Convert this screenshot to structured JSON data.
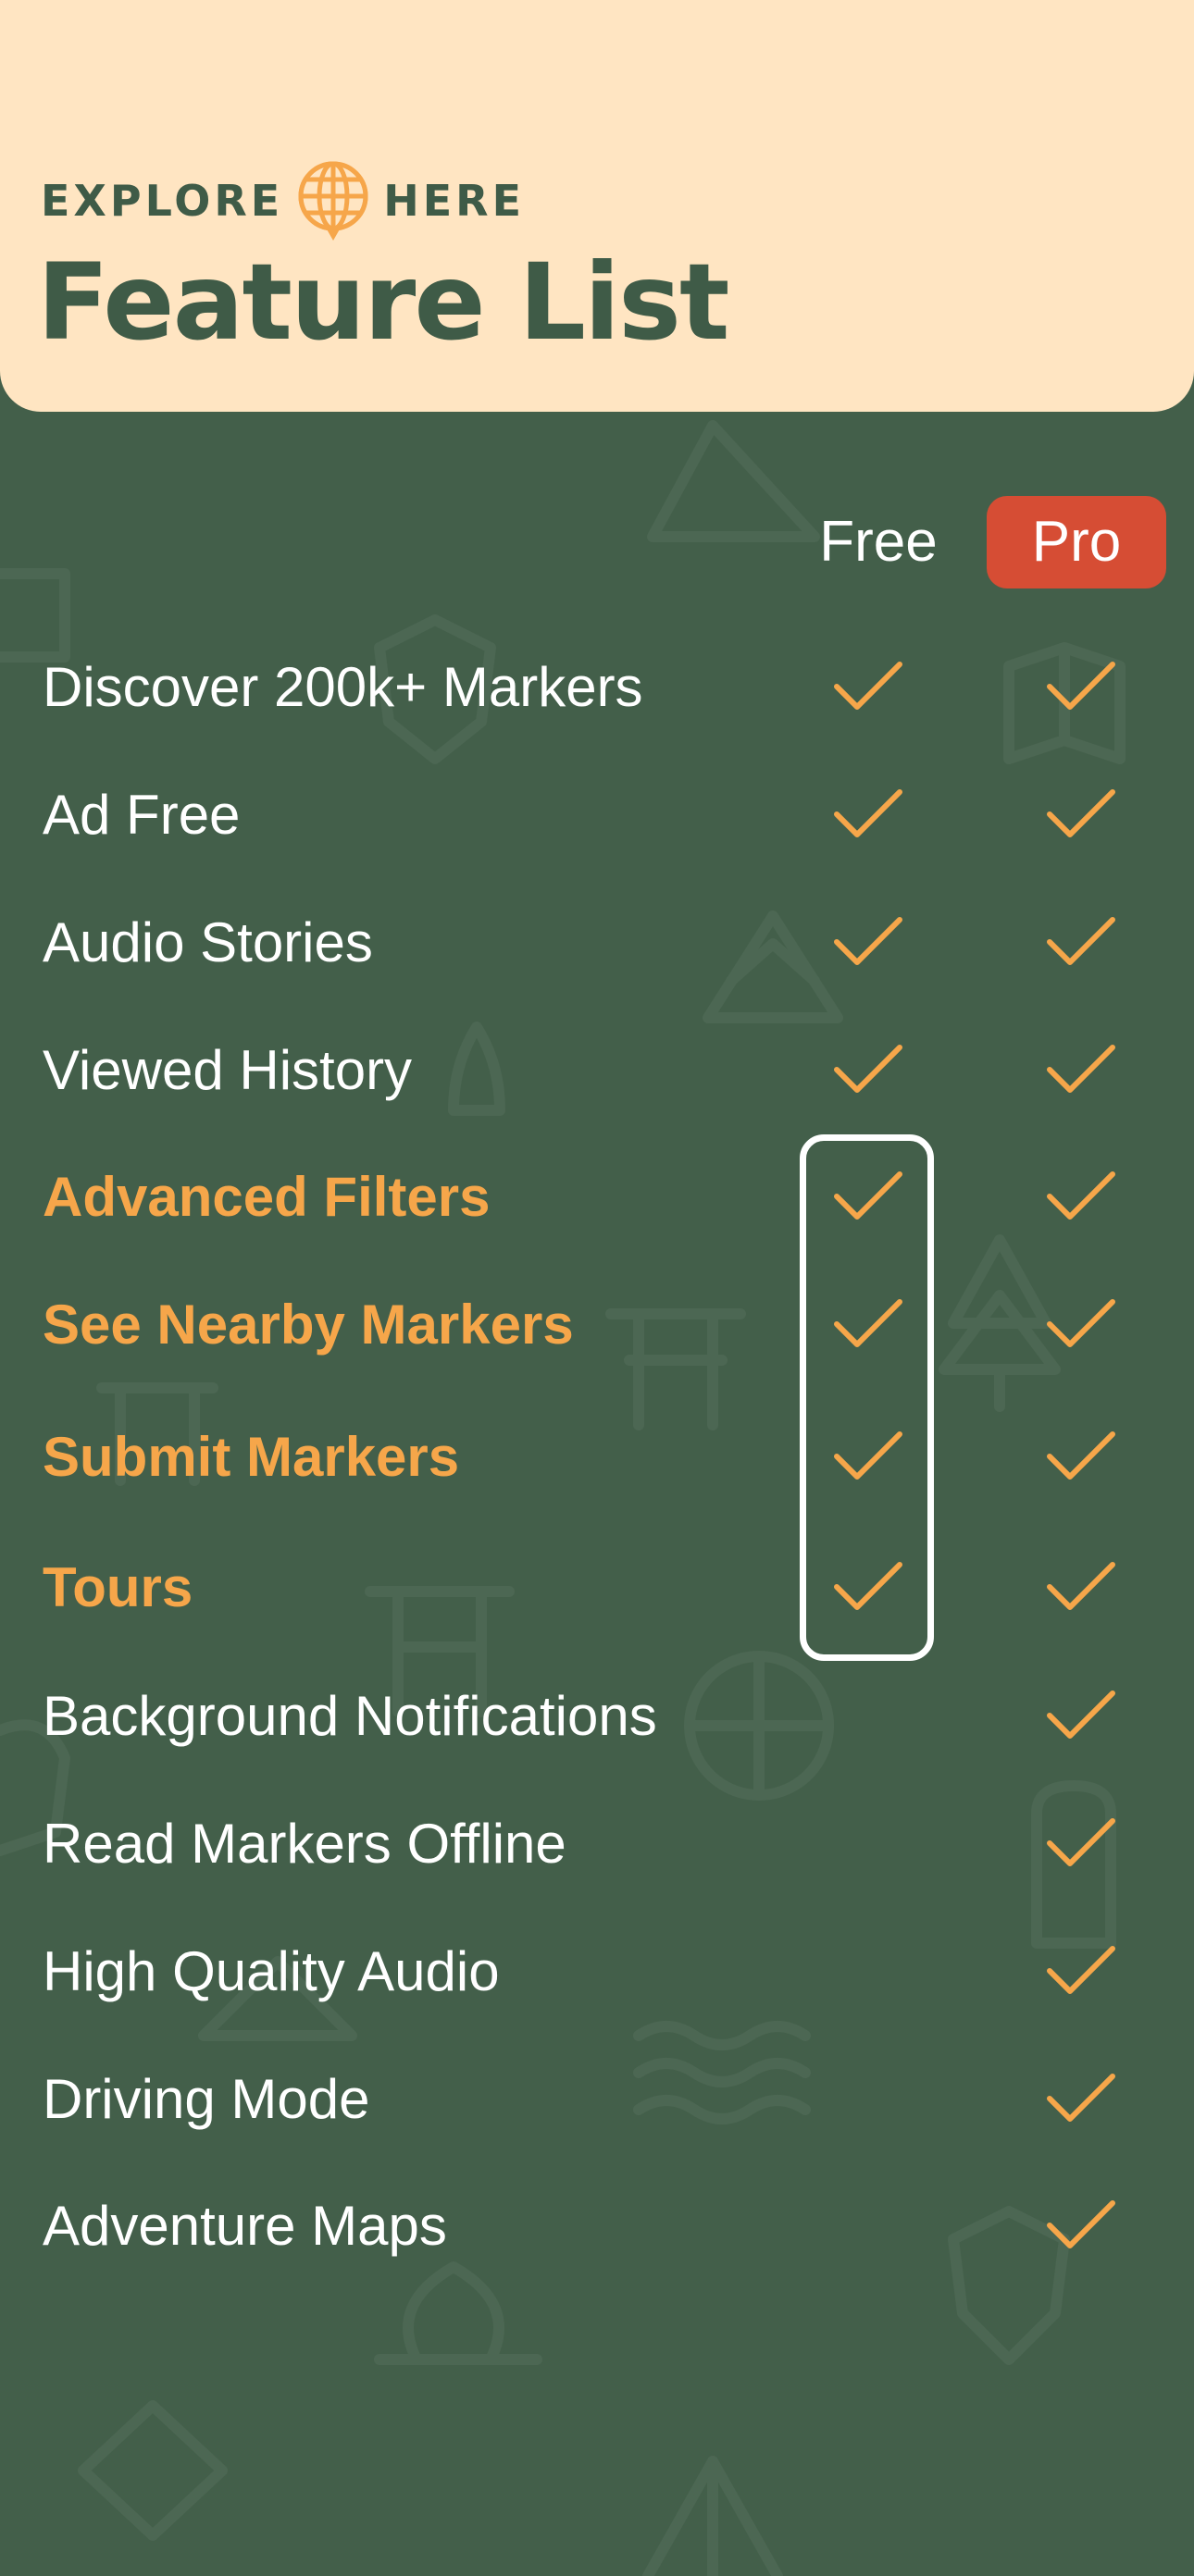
{
  "brand": {
    "left_text": "EXPLORE",
    "right_text": "HERE",
    "logo_icon": "globe-pin-icon"
  },
  "page_title": "Feature List",
  "columns": {
    "free_label": "Free",
    "pro_label": "Pro"
  },
  "colors": {
    "background": "#435f4a",
    "header_background": "#ffe5c2",
    "header_text": "#3f5b47",
    "accent": "#f6a64a",
    "pro_badge": "#d64d34",
    "text": "#ffffff"
  },
  "features": [
    {
      "label": "Discover 200k+ Markers",
      "free": true,
      "pro": true,
      "highlighted": false
    },
    {
      "label": "Ad Free",
      "free": true,
      "pro": true,
      "highlighted": false
    },
    {
      "label": "Audio Stories",
      "free": true,
      "pro": true,
      "highlighted": false
    },
    {
      "label": "Viewed History",
      "free": true,
      "pro": true,
      "highlighted": false
    },
    {
      "label": "Advanced Filters",
      "free": true,
      "pro": true,
      "highlighted": true
    },
    {
      "label": "See Nearby Markers",
      "free": true,
      "pro": true,
      "highlighted": true
    },
    {
      "label": "Submit Markers",
      "free": true,
      "pro": true,
      "highlighted": true
    },
    {
      "label": "Tours",
      "free": true,
      "pro": true,
      "highlighted": true
    },
    {
      "label": "Background Notifications",
      "free": false,
      "pro": true,
      "highlighted": false
    },
    {
      "label": "Read Markers Offline",
      "free": false,
      "pro": true,
      "highlighted": false
    },
    {
      "label": "High Quality Audio",
      "free": false,
      "pro": true,
      "highlighted": false
    },
    {
      "label": "Driving Mode",
      "free": false,
      "pro": true,
      "highlighted": false
    },
    {
      "label": "Adventure Maps",
      "free": false,
      "pro": true,
      "highlighted": false
    }
  ]
}
